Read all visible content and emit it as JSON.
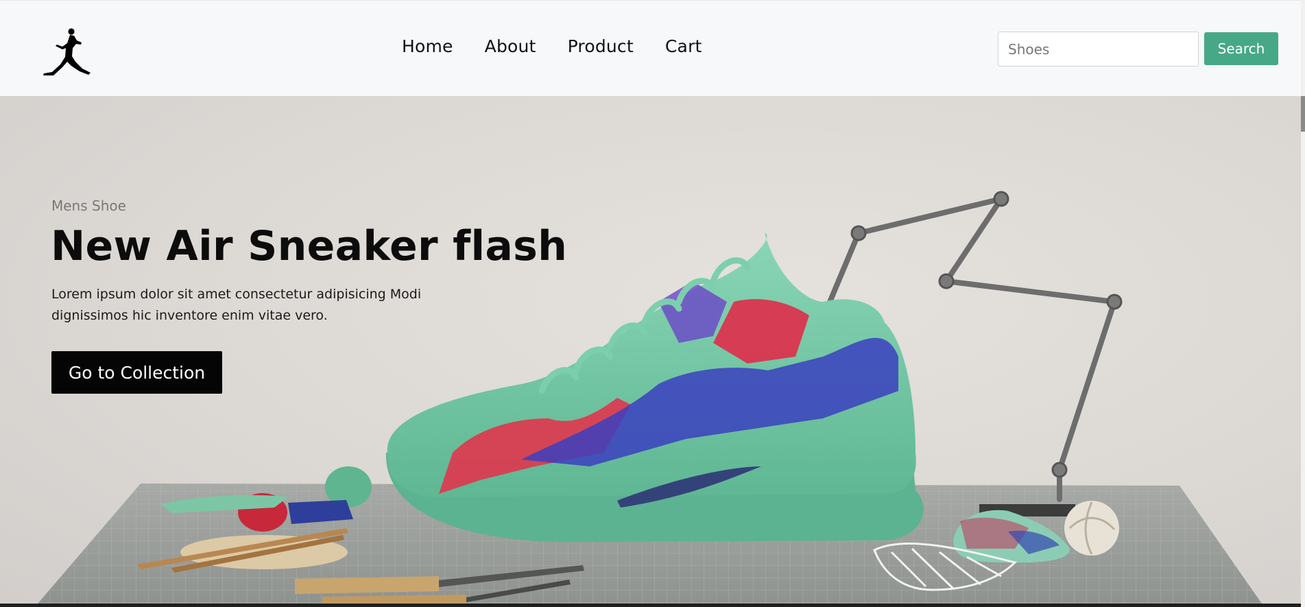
{
  "navbar": {
    "logo_name": "jumpman-logo",
    "links": [
      {
        "label": "Home"
      },
      {
        "label": "About"
      },
      {
        "label": "Product"
      },
      {
        "label": "Cart"
      }
    ],
    "search": {
      "value": "",
      "placeholder": "Shoes",
      "button_label": "Search"
    }
  },
  "hero": {
    "eyebrow": "Mens Shoe",
    "headline": "New Air Sneaker flash",
    "description": "Lorem ipsum dolor sit amet consectetur adipisicing Modi dignissimos hic inventore enim vitae vero.",
    "cta_label": "Go to Collection"
  },
  "colors": {
    "accent": "#47a888",
    "nav_bg": "#f7f8fa",
    "cta_bg": "#050505",
    "shoe_green": "#6fc5a2"
  }
}
